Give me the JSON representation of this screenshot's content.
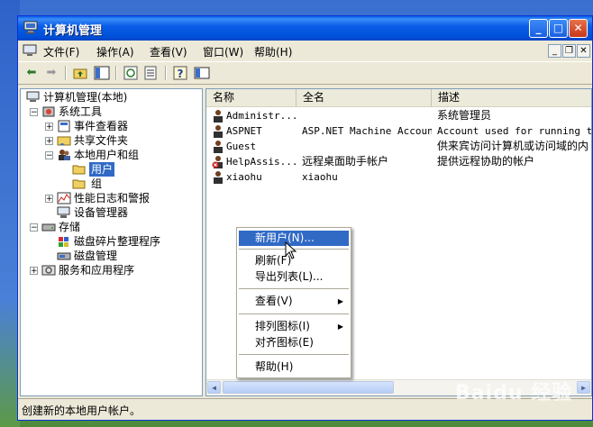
{
  "window": {
    "title": "计算机管理"
  },
  "menu": [
    {
      "label": "文件(F)"
    },
    {
      "label": "操作(A)"
    },
    {
      "label": "查看(V)"
    },
    {
      "label": "窗口(W)"
    },
    {
      "label": "帮助(H)"
    }
  ],
  "tree": [
    {
      "label": "计算机管理(本地)"
    },
    {
      "label": "系统工具"
    },
    {
      "label": "事件查看器"
    },
    {
      "label": "共享文件夹"
    },
    {
      "label": "本地用户和组"
    },
    {
      "label": "用户"
    },
    {
      "label": "组"
    },
    {
      "label": "性能日志和警报"
    },
    {
      "label": "设备管理器"
    },
    {
      "label": "存储"
    },
    {
      "label": "磁盘碎片整理程序"
    },
    {
      "label": "磁盘管理"
    },
    {
      "label": "服务和应用程序"
    }
  ],
  "columns": {
    "name": "名称",
    "fullname": "全名",
    "desc": "描述"
  },
  "users": [
    {
      "name": "Administr...",
      "fullname": "",
      "desc": "系统管理员"
    },
    {
      "name": "ASPNET",
      "fullname": "ASP.NET Machine Account",
      "desc": "Account used for running the"
    },
    {
      "name": "Guest",
      "fullname": "",
      "desc": "供来宾访问计算机或访问域的内"
    },
    {
      "name": "HelpAssis...",
      "fullname": "远程桌面助手帐户",
      "desc": "提供远程协助的帐户"
    },
    {
      "name": "xiaohu",
      "fullname": "xiaohu",
      "desc": ""
    }
  ],
  "context_menu": [
    {
      "label": "新用户(N)..."
    },
    {
      "label": "刷新(F)"
    },
    {
      "label": "导出列表(L)..."
    },
    {
      "label": "查看(V)"
    },
    {
      "label": "排列图标(I)"
    },
    {
      "label": "对齐图标(E)"
    },
    {
      "label": "帮助(H)"
    }
  ],
  "status": "创建新的本地用户帐户。",
  "watermark": "Baidu 经验",
  "colors": {
    "titlebar": "#0a5ee8",
    "selection": "#316ac5",
    "face": "#ece9d8"
  }
}
